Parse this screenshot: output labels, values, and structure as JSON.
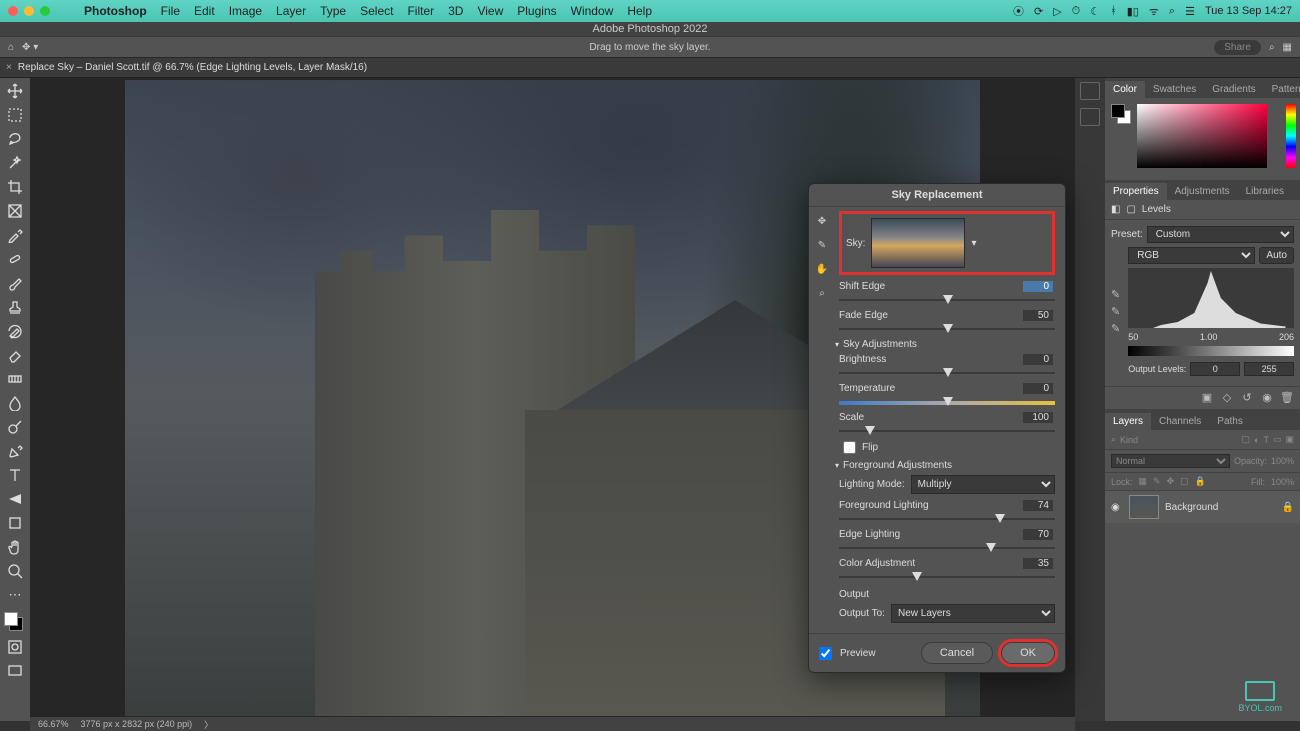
{
  "menubar": {
    "app": "Photoshop",
    "items": [
      "File",
      "Edit",
      "Image",
      "Layer",
      "Type",
      "Select",
      "Filter",
      "3D",
      "View",
      "Plugins",
      "Window",
      "Help"
    ],
    "clock": "Tue 13 Sep  14:27"
  },
  "titlebar": "Adobe Photoshop 2022",
  "optionsbar": {
    "hint": "Drag to move the sky layer.",
    "share": "Share"
  },
  "document_tab": "Replace Sky – Daniel Scott.tif @ 66.7% (Edge Lighting Levels, Layer Mask/16)",
  "status": {
    "zoom": "66.67%",
    "dims": "3776 px x 2832 px (240 ppi)"
  },
  "color_tabs": [
    "Color",
    "Swatches",
    "Gradients",
    "Patterns"
  ],
  "prop_tabs": [
    "Properties",
    "Adjustments",
    "Libraries"
  ],
  "properties": {
    "kind": "Levels",
    "preset_label": "Preset:",
    "preset": "Custom",
    "channel": "RGB",
    "auto": "Auto",
    "in_black": "50",
    "in_mid": "1.00",
    "in_white": "206",
    "out_label": "Output Levels:",
    "out_black": "0",
    "out_white": "255"
  },
  "layer_tabs": [
    "Layers",
    "Channels",
    "Paths"
  ],
  "layers": {
    "kind_label": "Kind",
    "blend": "Normal",
    "opacity_label": "Opacity:",
    "opacity": "100%",
    "lock_label": "Lock:",
    "fill_label": "Fill:",
    "fill": "100%",
    "bg_name": "Background"
  },
  "dialog": {
    "title": "Sky Replacement",
    "sky_label": "Sky:",
    "shift_edge": {
      "label": "Shift Edge",
      "value": "0"
    },
    "fade_edge": {
      "label": "Fade Edge",
      "value": "50"
    },
    "section_sky": "Sky Adjustments",
    "brightness": {
      "label": "Brightness",
      "value": "0"
    },
    "temperature": {
      "label": "Temperature",
      "value": "0"
    },
    "scale": {
      "label": "Scale",
      "value": "100"
    },
    "flip": "Flip",
    "section_fg": "Foreground Adjustments",
    "lighting_mode_label": "Lighting Mode:",
    "lighting_mode": "Multiply",
    "fg_lighting": {
      "label": "Foreground Lighting",
      "value": "74"
    },
    "edge_lighting": {
      "label": "Edge Lighting",
      "value": "70"
    },
    "color_adj": {
      "label": "Color Adjustment",
      "value": "35"
    },
    "section_output": "Output",
    "output_to_label": "Output To:",
    "output_to": "New Layers",
    "preview": "Preview",
    "cancel": "Cancel",
    "ok": "OK"
  },
  "byol": "BYOL.com"
}
